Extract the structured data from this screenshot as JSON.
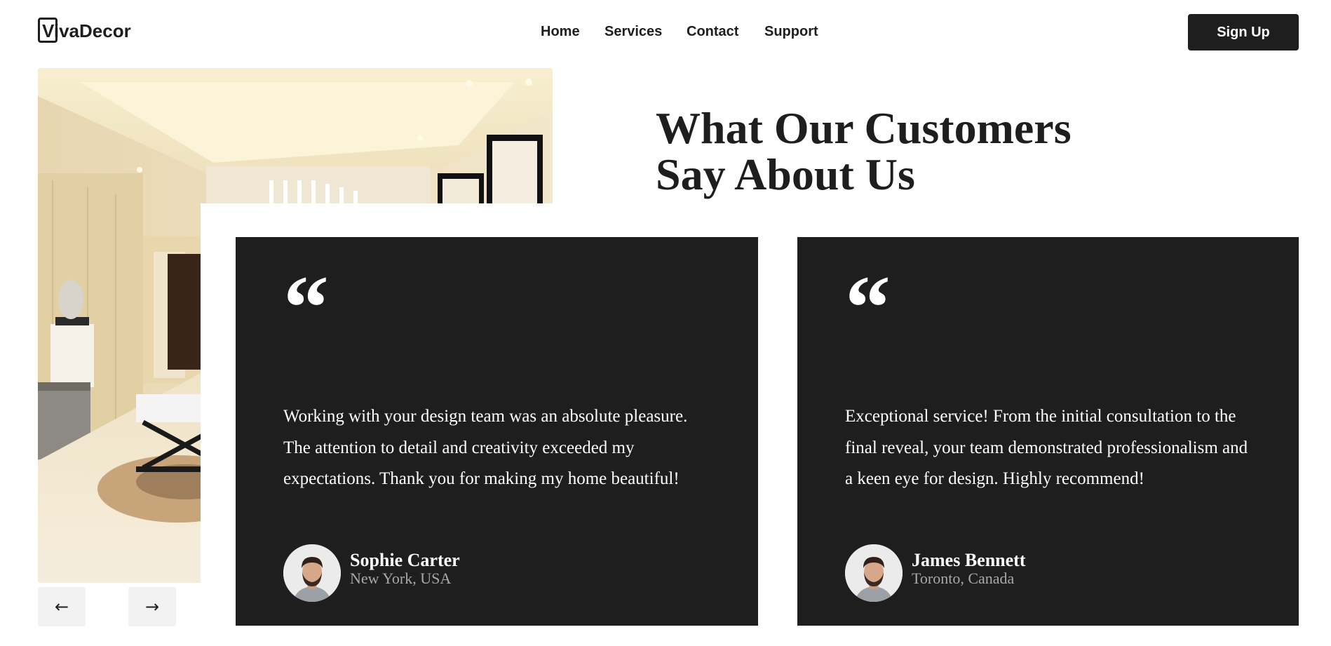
{
  "brand": {
    "logo": "VivaDecor"
  },
  "nav": {
    "items": [
      "Home",
      "Services",
      "Contact",
      "Support"
    ]
  },
  "header": {
    "signup_label": "Sign Up"
  },
  "section": {
    "title_line1": "What Our Customers",
    "title_line2": "Say About Us"
  },
  "carousel": {
    "prev_label": "←",
    "next_label": "→"
  },
  "testimonials": [
    {
      "quote_mark": "“",
      "text": "Working with your design team was an absolute pleasure. The attention to detail and creativity exceeded my expectations. Thank you for making my home beautiful!",
      "name": "Sophie Carter",
      "location": "New York, USA"
    },
    {
      "quote_mark": "“",
      "text": "Exceptional service! From the initial consultation to the final reveal, your team demonstrated professionalism and a keen eye for design. Highly recommend!",
      "name": "James Bennett",
      "location": "Toronto, Canada"
    }
  ],
  "colors": {
    "dark": "#1e1e1e",
    "muted": "#a9a9a9",
    "arrow_bg": "#f2f2f2"
  }
}
